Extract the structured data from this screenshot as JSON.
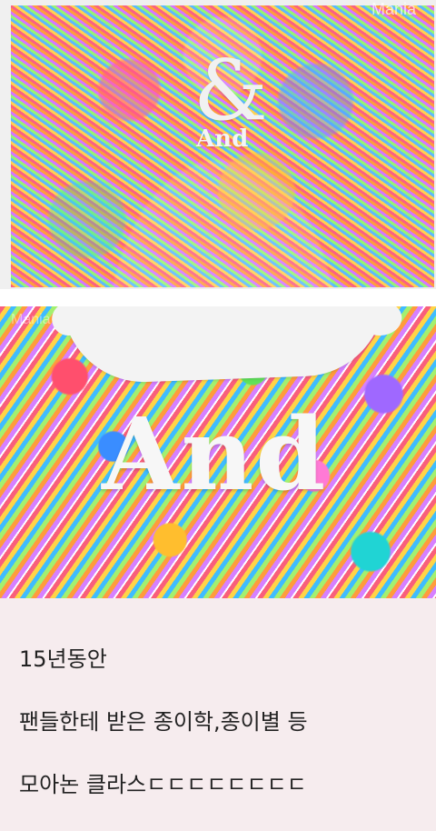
{
  "photo_top": {
    "watermark": "Mania",
    "ampersand": "&",
    "sign_text": "And"
  },
  "photo_bottom": {
    "watermark": "Mania",
    "sign_text": "And"
  },
  "caption": {
    "line1": "15년동안",
    "line2": "팬들한테 받은 종이학,종이별 등",
    "line3": "모아논 클라스ㄷㄷㄷㄷㄷㄷㄷㄷ"
  }
}
